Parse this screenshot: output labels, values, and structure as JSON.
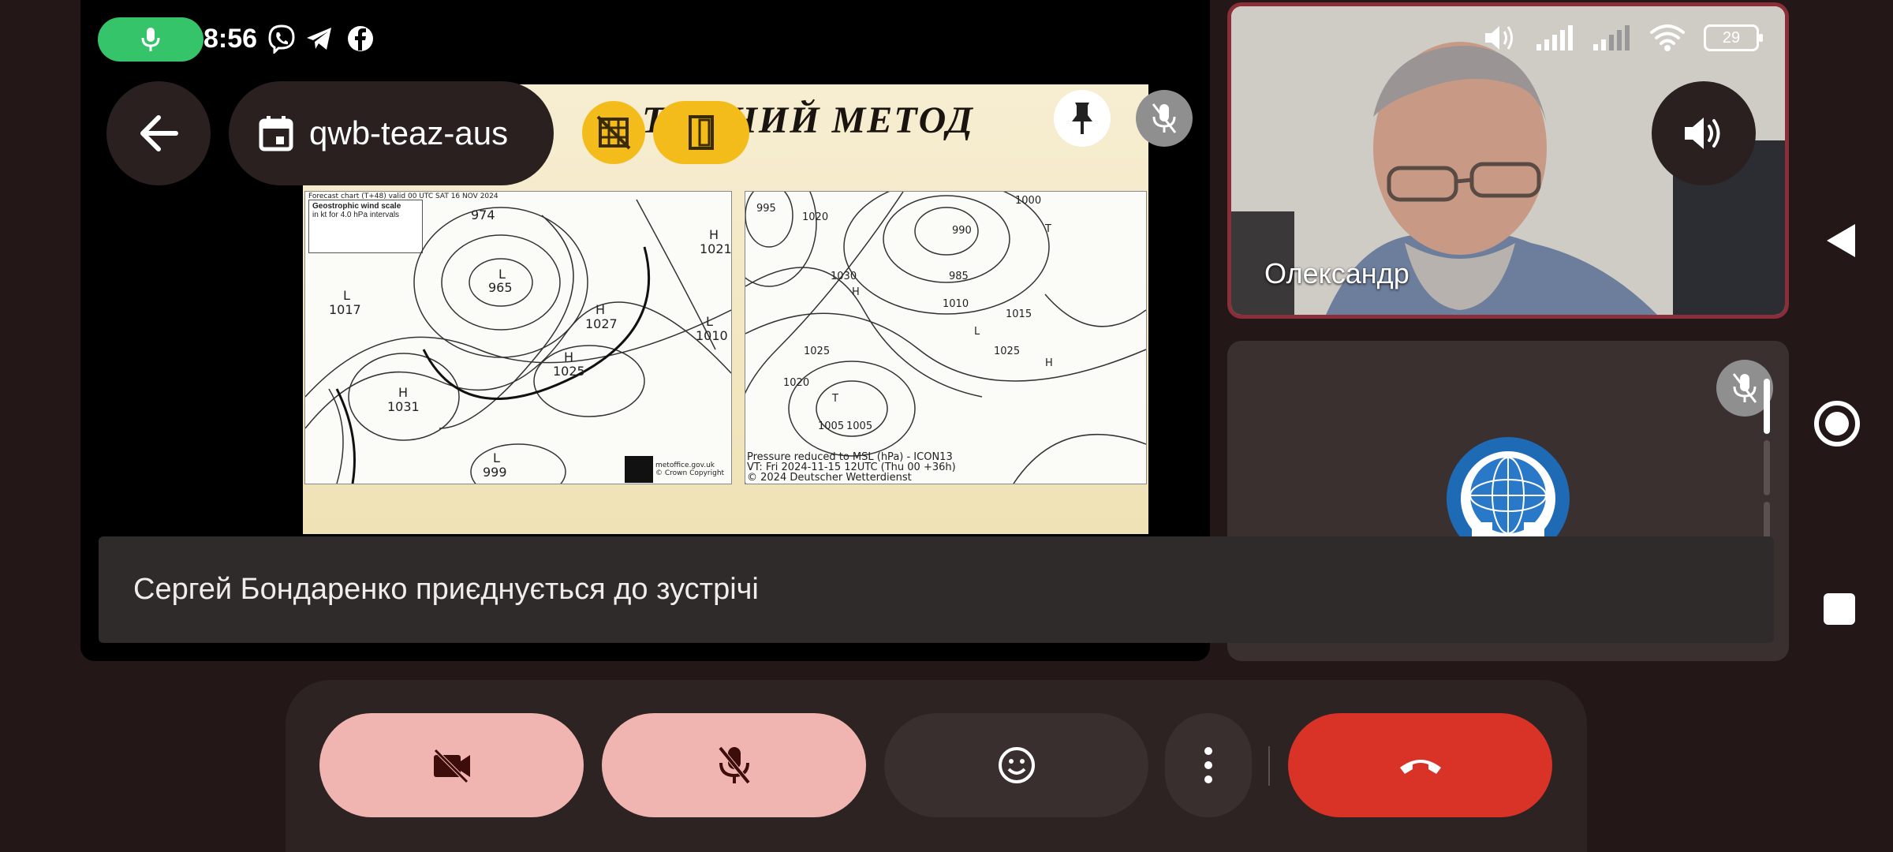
{
  "status_bar": {
    "time": "8:56",
    "battery": "29",
    "icons": [
      "viber-icon",
      "telegram-icon",
      "facebook-icon",
      "volume-icon",
      "signal-icon",
      "signal-icon",
      "wifi-icon",
      "battery-icon"
    ]
  },
  "meeting": {
    "code": "qwb-teaz-aus"
  },
  "slide": {
    "title": "…ТИЧНИЙ МЕТОД",
    "left_map": {
      "header": "Forecast chart (T+48) valid 00 UTC SAT 16 NOV 2024",
      "legend_title": "Geostrophic wind scale",
      "legend_sub": "in kt for 4.0 hPa intervals",
      "labels": [
        "974",
        "L",
        "965",
        "L",
        "1017",
        "H",
        "1027",
        "L",
        "1010",
        "H",
        "1025",
        "H",
        "1031",
        "L",
        "999",
        "H",
        "1021"
      ],
      "footer": "metoffice.gov.uk\n© Crown Copyright"
    },
    "right_map": {
      "labels": [
        "995",
        "1020",
        "1000",
        "990",
        "985",
        "1010",
        "1025",
        "1030",
        "1005",
        "T",
        "H",
        "1015",
        "L",
        "1020",
        "1005",
        "T",
        "1025",
        "H"
      ],
      "footer": "Pressure reduced to MSL (hPa) - ICON13\nVT: Fri 2024-11-15 12UTC (Thu 00 +36h)\n© 2024 Deutscher Wetterdienst"
    }
  },
  "participants": [
    {
      "name": "Олександр"
    }
  ],
  "toast": {
    "text": "Сергей Бондаренко приєднується до зустрічі"
  },
  "colors": {
    "background": "#231717",
    "mic_active": "#35c46a",
    "accent_yellow": "#f4bc1a",
    "muted_control": "#f0b5b1",
    "end_call": "#d93227",
    "speaker_border": "#8a2f3a"
  }
}
